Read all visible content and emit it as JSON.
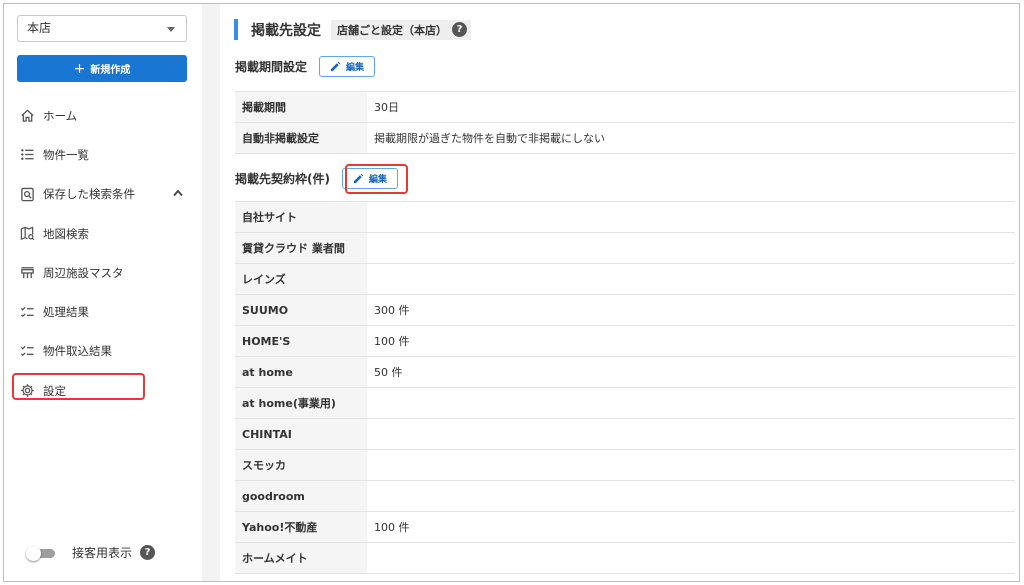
{
  "sidebar": {
    "store_select": {
      "value": "本店"
    },
    "new_button": {
      "label": "新規作成"
    },
    "nav": [
      {
        "label": "ホーム",
        "icon": "home-icon"
      },
      {
        "label": "物件一覧",
        "icon": "list-icon"
      },
      {
        "label": "保存した検索条件",
        "icon": "saved-search-icon",
        "expanded": true
      },
      {
        "label": "地図検索",
        "icon": "map-icon"
      },
      {
        "label": "周辺施設マスタ",
        "icon": "facility-icon"
      },
      {
        "label": "処理結果",
        "icon": "checklist-icon"
      },
      {
        "label": "物件取込結果",
        "icon": "checklist-icon"
      },
      {
        "label": "設定",
        "icon": "gear-icon",
        "highlighted": true
      }
    ],
    "guest_toggle": {
      "label": "接客用表示",
      "on": false
    }
  },
  "main": {
    "title": "掲載先設定",
    "store_chip": "店舗ごと設定（本店）",
    "period_section": {
      "heading": "掲載期間設定",
      "edit_label": "編集",
      "rows": [
        {
          "key": "掲載期間",
          "value": "30日"
        },
        {
          "key": "自動非掲載設定",
          "value": "掲載期限が過ぎた物件を自動で非掲載にしない"
        }
      ]
    },
    "quota_section": {
      "heading": "掲載先契約枠(件)",
      "edit_label": "編集",
      "rows": [
        {
          "key": "自社サイト",
          "value": ""
        },
        {
          "key": "賃貸クラウド 業者間",
          "value": ""
        },
        {
          "key": "レインズ",
          "value": ""
        },
        {
          "key": "SUUMO",
          "value": "300 件"
        },
        {
          "key": "HOME'S",
          "value": "100 件"
        },
        {
          "key": "at home",
          "value": "50 件"
        },
        {
          "key": "at home(事業用)",
          "value": ""
        },
        {
          "key": "CHINTAI",
          "value": ""
        },
        {
          "key": "スモッカ",
          "value": ""
        },
        {
          "key": "goodroom",
          "value": ""
        },
        {
          "key": "Yahoo!不動産",
          "value": "100 件"
        },
        {
          "key": "ホームメイト",
          "value": ""
        }
      ]
    }
  },
  "colors": {
    "primary": "#1976d2",
    "accent_bar": "#3b8de0",
    "highlight": "#e53935"
  }
}
